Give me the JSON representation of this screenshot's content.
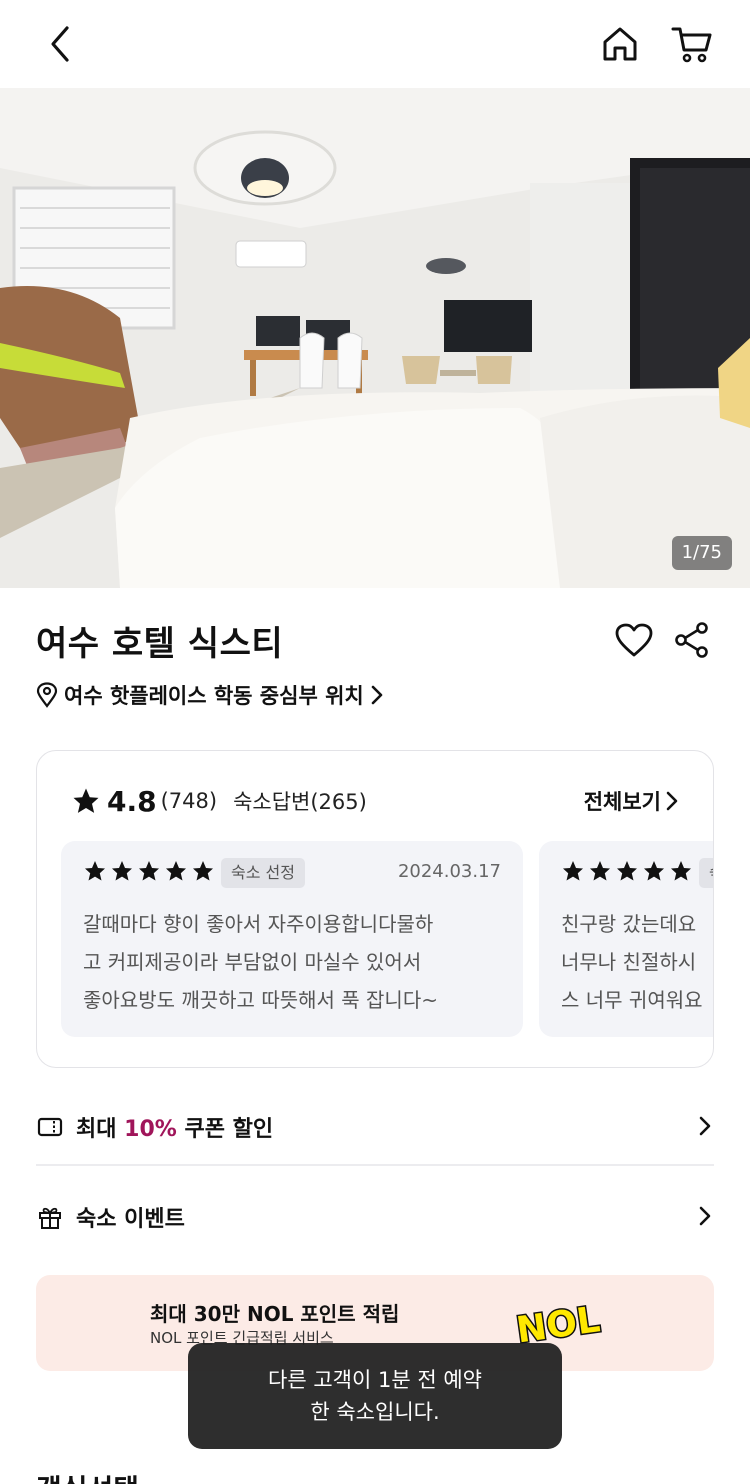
{
  "header": {
    "back_icon": "chevron-left-icon",
    "home_icon": "home-icon",
    "cart_icon": "cart-icon"
  },
  "gallery": {
    "counter": "1/75"
  },
  "hotel": {
    "name": "여수 호텔 식스티",
    "location": "여수 핫플레이스 학동 중심부 위치"
  },
  "reviews": {
    "rating": "4.8",
    "count": "(748)",
    "host_replies": "숙소답변(265)",
    "see_all": "전체보기",
    "items": [
      {
        "stars": 5,
        "badge": "숙소 선정",
        "date": "2024.03.17",
        "text": "갈때마다 향이 좋아서 자주이용합니다물하\n고 커피제공이라 부담없이 마실수 있어서\n좋아요방도 깨끗하고 따뜻해서 푹 잡니다~"
      },
      {
        "stars": 5,
        "badge": "숙",
        "date": "",
        "text": "친구랑 갔는데요\n너무나 친절하시\n스 너무 귀여워요"
      }
    ]
  },
  "benefits": {
    "coupon_prefix": "최대 ",
    "coupon_accent": "10%",
    "coupon_suffix": " 쿠폰 할인",
    "event_label": "숙소 이벤트"
  },
  "promo": {
    "title": "최대 30만 NOL 포인트 적립",
    "subtitle": "NOL 포인트 긴급적립 서비스",
    "logo": "NOL"
  },
  "toast": {
    "message": "다른 고객이 1분 전 예약\n한 숙소입니다."
  },
  "section_peek": {
    "title": "객실선택"
  },
  "colors": {
    "accent": "#a0155a",
    "promo_bg": "#fcebe6",
    "logo_yellow": "#ffe800"
  }
}
